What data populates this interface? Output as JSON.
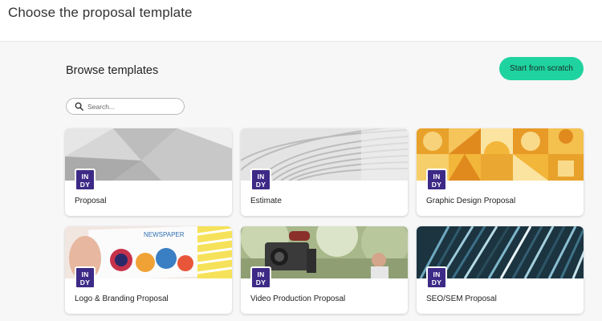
{
  "page": {
    "title": "Choose the proposal template"
  },
  "browse": {
    "title": "Browse templates",
    "scratch_button": "Start from scratch",
    "search_placeholder": "Search..."
  },
  "brand": {
    "badge_line1": "IN",
    "badge_line2": "DY",
    "badge_color": "#3d2a86",
    "accent": "#1fd3a0"
  },
  "templates": [
    {
      "label": "Proposal"
    },
    {
      "label": "Estimate"
    },
    {
      "label": "Graphic Design Proposal"
    },
    {
      "label": "Logo & Branding Proposal",
      "thumb_text": "NEWSPAPER"
    },
    {
      "label": "Video Production Proposal"
    },
    {
      "label": "SEO/SEM Proposal"
    }
  ]
}
